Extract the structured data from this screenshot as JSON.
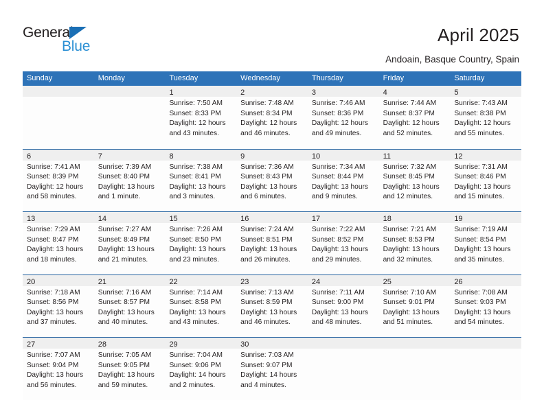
{
  "brand": {
    "name_part1": "General",
    "name_part2": "Blue",
    "accent_color": "#2a8fd4",
    "triangle_color": "#1a6fb5",
    "triangle_icon": "triangle-icon"
  },
  "header": {
    "month_title": "April 2025",
    "location": "Andoain, Basque Country, Spain"
  },
  "calendar": {
    "header_bg": "#2e73b8",
    "week_separator_color": "#205f9e",
    "daynum_band_bg": "#efefef",
    "weekdays": [
      "Sunday",
      "Monday",
      "Tuesday",
      "Wednesday",
      "Thursday",
      "Friday",
      "Saturday"
    ],
    "weeks": [
      [
        {
          "day": "",
          "lines": []
        },
        {
          "day": "",
          "lines": []
        },
        {
          "day": "1",
          "lines": [
            "Sunrise: 7:50 AM",
            "Sunset: 8:33 PM",
            "Daylight: 12 hours",
            "and 43 minutes."
          ]
        },
        {
          "day": "2",
          "lines": [
            "Sunrise: 7:48 AM",
            "Sunset: 8:34 PM",
            "Daylight: 12 hours",
            "and 46 minutes."
          ]
        },
        {
          "day": "3",
          "lines": [
            "Sunrise: 7:46 AM",
            "Sunset: 8:36 PM",
            "Daylight: 12 hours",
            "and 49 minutes."
          ]
        },
        {
          "day": "4",
          "lines": [
            "Sunrise: 7:44 AM",
            "Sunset: 8:37 PM",
            "Daylight: 12 hours",
            "and 52 minutes."
          ]
        },
        {
          "day": "5",
          "lines": [
            "Sunrise: 7:43 AM",
            "Sunset: 8:38 PM",
            "Daylight: 12 hours",
            "and 55 minutes."
          ]
        }
      ],
      [
        {
          "day": "6",
          "lines": [
            "Sunrise: 7:41 AM",
            "Sunset: 8:39 PM",
            "Daylight: 12 hours",
            "and 58 minutes."
          ]
        },
        {
          "day": "7",
          "lines": [
            "Sunrise: 7:39 AM",
            "Sunset: 8:40 PM",
            "Daylight: 13 hours",
            "and 1 minute."
          ]
        },
        {
          "day": "8",
          "lines": [
            "Sunrise: 7:38 AM",
            "Sunset: 8:41 PM",
            "Daylight: 13 hours",
            "and 3 minutes."
          ]
        },
        {
          "day": "9",
          "lines": [
            "Sunrise: 7:36 AM",
            "Sunset: 8:43 PM",
            "Daylight: 13 hours",
            "and 6 minutes."
          ]
        },
        {
          "day": "10",
          "lines": [
            "Sunrise: 7:34 AM",
            "Sunset: 8:44 PM",
            "Daylight: 13 hours",
            "and 9 minutes."
          ]
        },
        {
          "day": "11",
          "lines": [
            "Sunrise: 7:32 AM",
            "Sunset: 8:45 PM",
            "Daylight: 13 hours",
            "and 12 minutes."
          ]
        },
        {
          "day": "12",
          "lines": [
            "Sunrise: 7:31 AM",
            "Sunset: 8:46 PM",
            "Daylight: 13 hours",
            "and 15 minutes."
          ]
        }
      ],
      [
        {
          "day": "13",
          "lines": [
            "Sunrise: 7:29 AM",
            "Sunset: 8:47 PM",
            "Daylight: 13 hours",
            "and 18 minutes."
          ]
        },
        {
          "day": "14",
          "lines": [
            "Sunrise: 7:27 AM",
            "Sunset: 8:49 PM",
            "Daylight: 13 hours",
            "and 21 minutes."
          ]
        },
        {
          "day": "15",
          "lines": [
            "Sunrise: 7:26 AM",
            "Sunset: 8:50 PM",
            "Daylight: 13 hours",
            "and 23 minutes."
          ]
        },
        {
          "day": "16",
          "lines": [
            "Sunrise: 7:24 AM",
            "Sunset: 8:51 PM",
            "Daylight: 13 hours",
            "and 26 minutes."
          ]
        },
        {
          "day": "17",
          "lines": [
            "Sunrise: 7:22 AM",
            "Sunset: 8:52 PM",
            "Daylight: 13 hours",
            "and 29 minutes."
          ]
        },
        {
          "day": "18",
          "lines": [
            "Sunrise: 7:21 AM",
            "Sunset: 8:53 PM",
            "Daylight: 13 hours",
            "and 32 minutes."
          ]
        },
        {
          "day": "19",
          "lines": [
            "Sunrise: 7:19 AM",
            "Sunset: 8:54 PM",
            "Daylight: 13 hours",
            "and 35 minutes."
          ]
        }
      ],
      [
        {
          "day": "20",
          "lines": [
            "Sunrise: 7:18 AM",
            "Sunset: 8:56 PM",
            "Daylight: 13 hours",
            "and 37 minutes."
          ]
        },
        {
          "day": "21",
          "lines": [
            "Sunrise: 7:16 AM",
            "Sunset: 8:57 PM",
            "Daylight: 13 hours",
            "and 40 minutes."
          ]
        },
        {
          "day": "22",
          "lines": [
            "Sunrise: 7:14 AM",
            "Sunset: 8:58 PM",
            "Daylight: 13 hours",
            "and 43 minutes."
          ]
        },
        {
          "day": "23",
          "lines": [
            "Sunrise: 7:13 AM",
            "Sunset: 8:59 PM",
            "Daylight: 13 hours",
            "and 46 minutes."
          ]
        },
        {
          "day": "24",
          "lines": [
            "Sunrise: 7:11 AM",
            "Sunset: 9:00 PM",
            "Daylight: 13 hours",
            "and 48 minutes."
          ]
        },
        {
          "day": "25",
          "lines": [
            "Sunrise: 7:10 AM",
            "Sunset: 9:01 PM",
            "Daylight: 13 hours",
            "and 51 minutes."
          ]
        },
        {
          "day": "26",
          "lines": [
            "Sunrise: 7:08 AM",
            "Sunset: 9:03 PM",
            "Daylight: 13 hours",
            "and 54 minutes."
          ]
        }
      ],
      [
        {
          "day": "27",
          "lines": [
            "Sunrise: 7:07 AM",
            "Sunset: 9:04 PM",
            "Daylight: 13 hours",
            "and 56 minutes."
          ]
        },
        {
          "day": "28",
          "lines": [
            "Sunrise: 7:05 AM",
            "Sunset: 9:05 PM",
            "Daylight: 13 hours",
            "and 59 minutes."
          ]
        },
        {
          "day": "29",
          "lines": [
            "Sunrise: 7:04 AM",
            "Sunset: 9:06 PM",
            "Daylight: 14 hours",
            "and 2 minutes."
          ]
        },
        {
          "day": "30",
          "lines": [
            "Sunrise: 7:03 AM",
            "Sunset: 9:07 PM",
            "Daylight: 14 hours",
            "and 4 minutes."
          ]
        },
        {
          "day": "",
          "lines": []
        },
        {
          "day": "",
          "lines": []
        },
        {
          "day": "",
          "lines": []
        }
      ]
    ]
  }
}
